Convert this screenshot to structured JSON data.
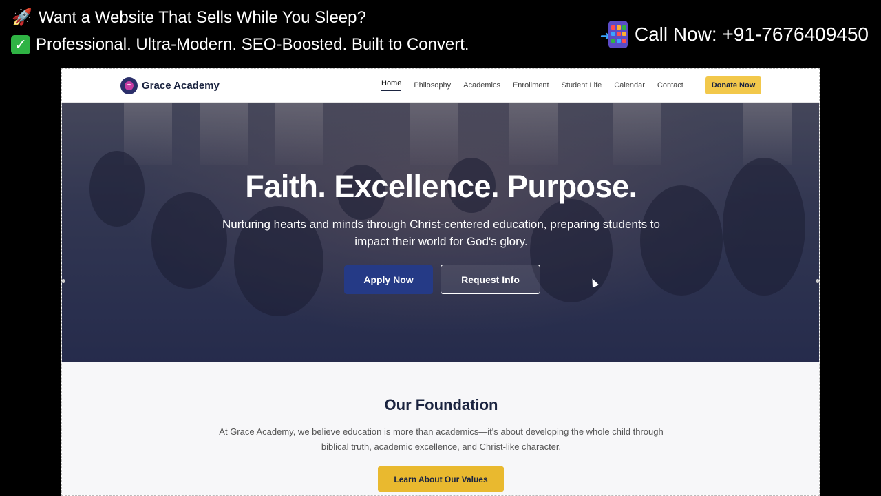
{
  "promo": {
    "line1": "Want a Website That Sells While You Sleep?",
    "line2": "Professional. Ultra-Modern. SEO-Boosted. Built to Convert.",
    "call": "Call Now: +91-7676409450"
  },
  "site": {
    "brand": "Grace Academy",
    "nav": [
      "Home",
      "Philosophy",
      "Academics",
      "Enrollment",
      "Student Life",
      "Calendar",
      "Contact"
    ],
    "donate": "Donate Now",
    "hero": {
      "title": "Faith. Excellence. Purpose.",
      "subtitle": "Nurturing hearts and minds through Christ-centered education, preparing students to impact their world for God's glory.",
      "apply": "Apply Now",
      "request": "Request Info"
    },
    "foundation": {
      "title": "Our Foundation",
      "text": "At Grace Academy, we believe education is more than academics—it's about developing the whole child through biblical truth, academic excellence, and Christ-like character.",
      "button": "Learn About Our Values"
    }
  },
  "colors": {
    "navy": "#1b2440",
    "gold": "#f2c84b",
    "apply_blue": "#253a86"
  }
}
